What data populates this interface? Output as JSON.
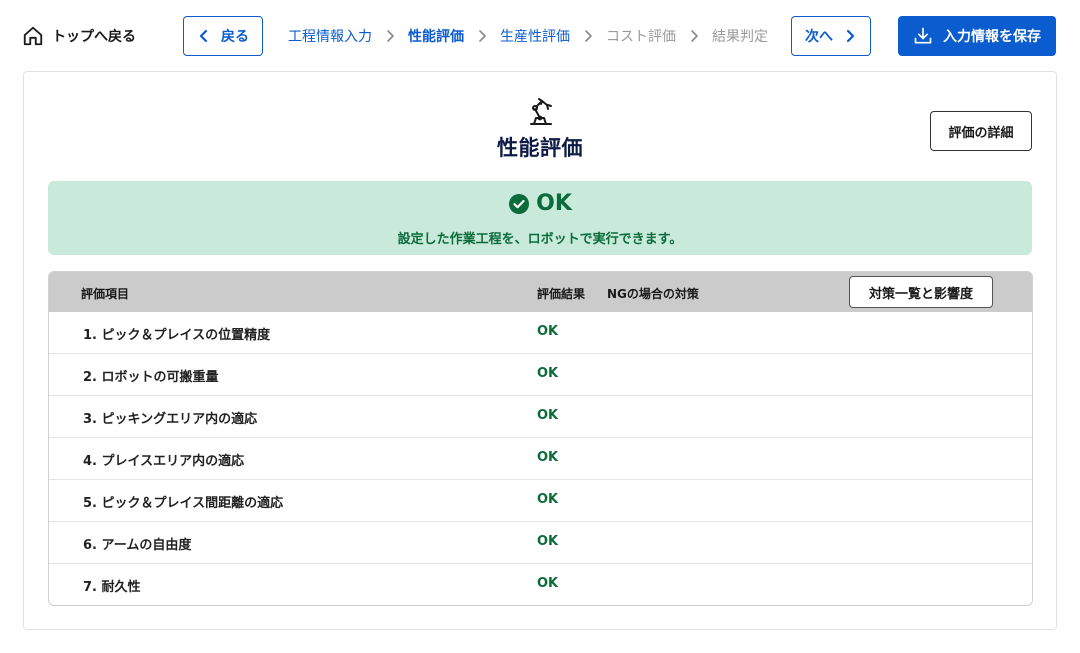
{
  "header": {
    "home_label": "トップへ戻る",
    "back_label": "戻る",
    "next_label": "次へ",
    "save_label": "入力情報を保存",
    "steps": [
      {
        "label": "工程情報入力",
        "state": "link"
      },
      {
        "label": "性能評価",
        "state": "current"
      },
      {
        "label": "生産性評価",
        "state": "link"
      },
      {
        "label": "コスト評価",
        "state": "future"
      },
      {
        "label": "結果判定",
        "state": "future"
      }
    ]
  },
  "main": {
    "title": "性能評価",
    "detail_button_label": "評価の詳細",
    "result": {
      "status": "OK",
      "message": "設定した作業工程を、ロボットで実行できます。"
    },
    "table": {
      "headers": {
        "item": "評価項目",
        "result": "評価結果",
        "measure": "NGの場合の対策"
      },
      "measures_button_label": "対策一覧と影響度",
      "rows": [
        {
          "item": "1. ピック＆プレイスの位置精度",
          "result": "OK",
          "measure": ""
        },
        {
          "item": "2. ロボットの可搬重量",
          "result": "OK",
          "measure": ""
        },
        {
          "item": "3. ピッキングエリア内の適応",
          "result": "OK",
          "measure": ""
        },
        {
          "item": "4. プレイスエリア内の適応",
          "result": "OK",
          "measure": ""
        },
        {
          "item": "5. ピック＆プレイス間距離の適応",
          "result": "OK",
          "measure": ""
        },
        {
          "item": "6. アームの自由度",
          "result": "OK",
          "measure": ""
        },
        {
          "item": "7. 耐久性",
          "result": "OK",
          "measure": ""
        }
      ]
    }
  },
  "colors": {
    "primary": "#0b5ccf",
    "ok_text": "#0b6b3a",
    "ok_background": "#c9eadb",
    "title": "#0d1b45",
    "table_header": "#cbcbcb",
    "inactive_step": "#9a9a9a"
  },
  "icons": {
    "home": "home-icon",
    "back": "chevron-left-icon",
    "next": "chevron-right-icon",
    "step_separator": "chevron-right-icon",
    "save": "download-icon",
    "title": "robot-arm-icon",
    "status": "check-circle-icon"
  }
}
